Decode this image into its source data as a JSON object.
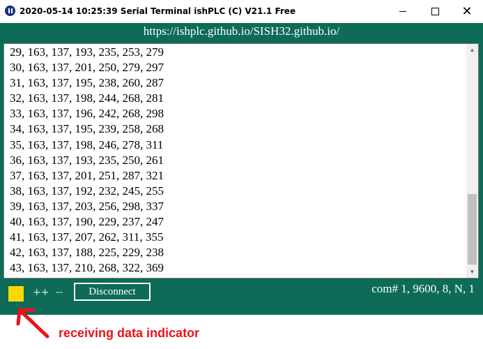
{
  "window": {
    "title": "2020-05-14 10:25:39   Serial Terminal ishPLC (C) V21.1 Free",
    "icon": "app-icon",
    "controls": {
      "minimize": "minimize-icon",
      "maximize": "maximize-icon",
      "close": "close-icon",
      "close_glyph": "✕"
    }
  },
  "header": {
    "url": "https://ishplc.github.io/SISH32.github.io/"
  },
  "terminal": {
    "lines": [
      "29, 163, 137, 193, 235, 253, 279",
      "30, 163, 137, 201, 250, 279, 297",
      "31, 163, 137, 195, 238, 260, 287",
      "32, 163, 137, 198, 244, 268, 281",
      "33, 163, 137, 196, 242, 268, 298",
      "34, 163, 137, 195, 239, 258, 268",
      "35, 163, 137, 198, 246, 278, 311",
      "36, 163, 137, 193, 235, 250, 261",
      "37, 163, 137, 201, 251, 287, 321",
      "38, 163, 137, 192, 232, 245, 255",
      "39, 163, 137, 203, 256, 298, 337",
      "40, 163, 137, 190, 229, 237, 247",
      "41, 163, 137, 207, 262, 311, 355",
      "42, 163, 137, 188, 225, 229, 238",
      "43, 163, 137, 210, 268, 322, 369"
    ],
    "scroll_up_glyph": "▲",
    "scroll_down_glyph": "▼"
  },
  "footer": {
    "plus_label": "++",
    "minus_label": "--",
    "disconnect_label": "Disconnect",
    "com_status": "com# 1, 9600, 8, N, 1"
  },
  "annotation": {
    "text": "receiving data indicator"
  },
  "colors": {
    "frame": "#0d6b57",
    "indicator": "#ffd800",
    "annotation": "#e8141c",
    "text_light": "#ffffff"
  }
}
